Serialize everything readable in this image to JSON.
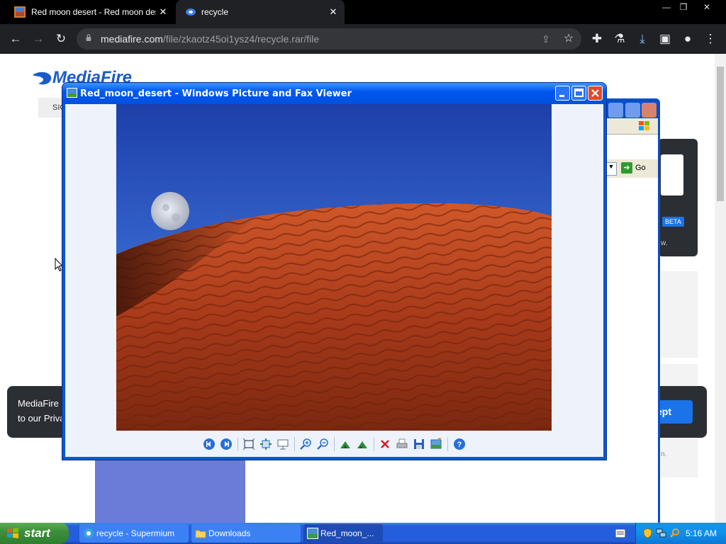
{
  "browser": {
    "tabs": [
      {
        "title": "Red moon desert - Red moon deser"
      },
      {
        "title": "recycle"
      }
    ],
    "url": {
      "host": "mediafire.com",
      "path": "/file/zkaotz45oi1ysz4/recycle.rar/file"
    }
  },
  "mediafire": {
    "logo": "MediaFire",
    "signin_partial": "SIG",
    "beta_badge": "BETA",
    "cookie_line1": "MediaFire u",
    "cookie_line2": "to our Priva",
    "accept_partial": "ept",
    "side_text_w": "w.",
    "side_text_m": "n."
  },
  "ie_window": {
    "go_label": "Go"
  },
  "viewer": {
    "title": "Red_moon_desert - Windows Picture and Fax Viewer",
    "toolbar": [
      "previous-image",
      "next-image",
      "best-fit",
      "actual-size",
      "slideshow",
      "zoom-in",
      "zoom-out",
      "rotate-clockwise",
      "rotate-counterclockwise",
      "delete",
      "print",
      "copy-to",
      "open-for-editing",
      "help"
    ]
  },
  "taskbar": {
    "start_label": "start",
    "tasks": [
      {
        "label": "recycle - Supermium",
        "icon": "browser-icon"
      },
      {
        "label": "Downloads",
        "icon": "folder-icon"
      },
      {
        "label": "Red_moon_...",
        "icon": "picture-viewer-icon"
      }
    ],
    "clock": "5:16 AM"
  },
  "colors": {
    "xp_blue": "#245edc",
    "chrome_dark": "#202124",
    "accent_blue": "#1a73e8"
  }
}
